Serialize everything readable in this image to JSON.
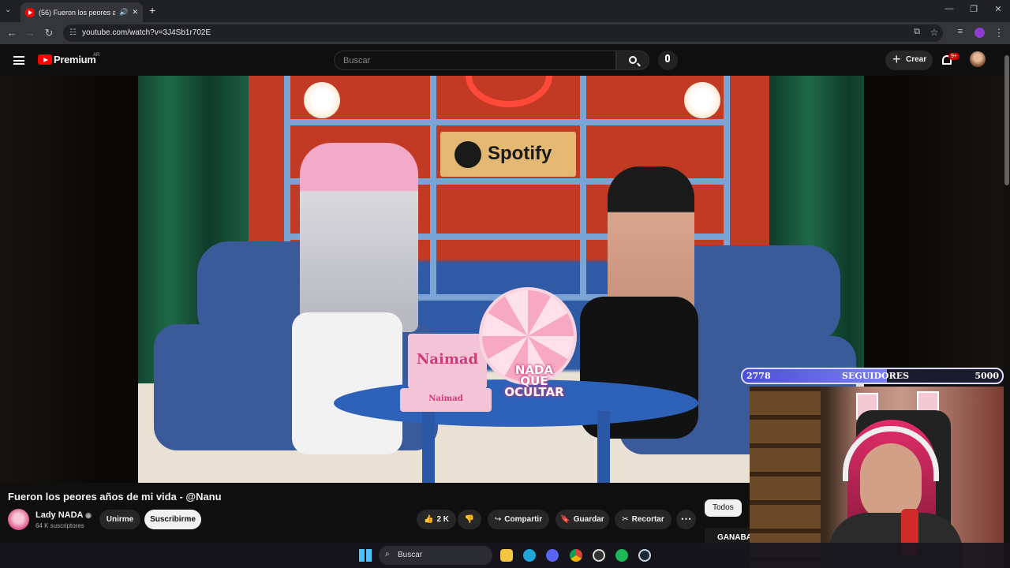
{
  "browser": {
    "tab_title": "(56) Fueron los peores años de mi vida - @Nanu",
    "url": "youtube.com/watch?v=3J4Sb1r702E",
    "new_tab": "+",
    "minimize": "—",
    "restore": "❐",
    "close": "✕"
  },
  "youtube": {
    "brand": "Premium",
    "country": "AR",
    "search_placeholder": "Buscar",
    "create_label": "Crear",
    "notifications_badge": "9+"
  },
  "video": {
    "title": "Fueron los peores años de mi vida - @Nanu",
    "scene_spotify": "Spotify",
    "scene_box_brand": "Naimad",
    "scene_sign": "NADA QUE OCULTAR"
  },
  "channel": {
    "name": "Lady NADA",
    "subscribers": "64 K suscriptores",
    "join_label": "Unirme",
    "subscribe_label": "Suscribirme"
  },
  "actions": {
    "likes": "2 K",
    "share": "Compartir",
    "save": "Guardar",
    "clip": "Recortar",
    "more": "⋯"
  },
  "sidebar": {
    "chip_all": "Todos",
    "peek_text": "GANABA"
  },
  "overlay": {
    "followers_current": "2778",
    "followers_label": "SEGUIDORES",
    "followers_goal": "5000",
    "followers_progress": 0.5556
  },
  "taskbar": {
    "search_label": "Buscar"
  },
  "colors": {
    "youtube_red": "#ff0000",
    "goal_bar": "#5a5ee0"
  }
}
